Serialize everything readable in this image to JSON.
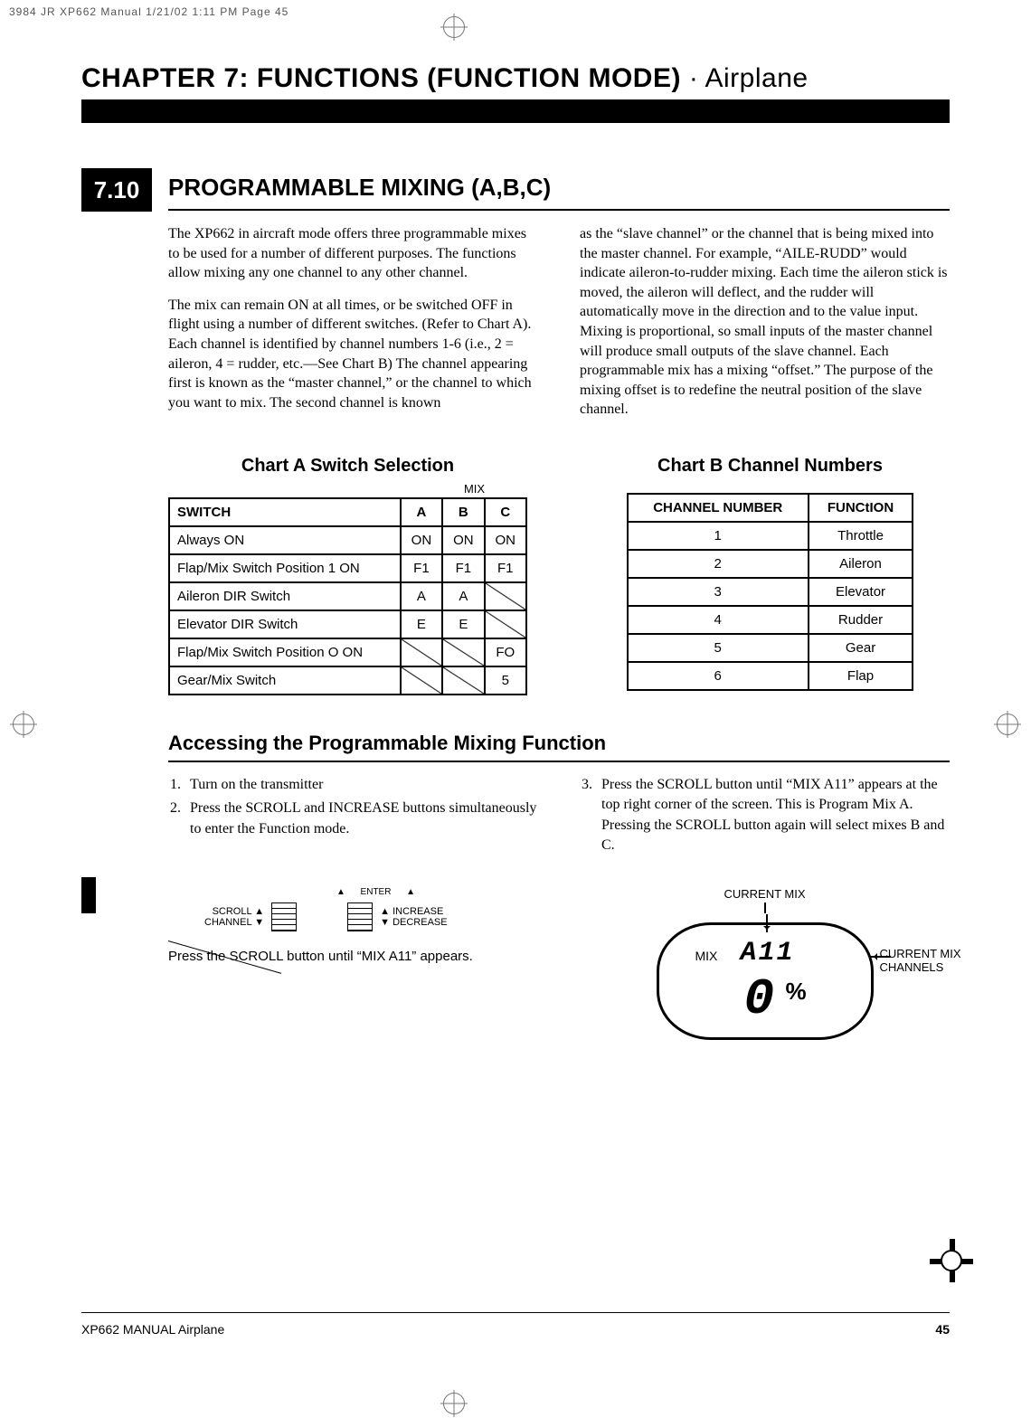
{
  "meta": {
    "print_header": "3984 JR XP662 Manual   1/21/02   1:11 PM   Page 45"
  },
  "chapter": {
    "prefix": "CHAPTER 7: FUNCTIONS (FUNCTION MODE)",
    "suffix_sep": " · ",
    "suffix": "Airplane"
  },
  "section": {
    "number": "7.10",
    "title": "PROGRAMMABLE MIXING (A,B,C)"
  },
  "body": {
    "left_p1": "The XP662 in aircraft mode offers three programmable mixes to be used for a number of different purposes. The functions allow mixing any one channel to any other channel.",
    "left_p2": "The mix can remain ON at all times, or be switched OFF in flight using a number of different switches. (Refer to Chart A). Each channel is identified by channel numbers 1-6 (i.e., 2 = aileron, 4 = rudder, etc.—See Chart B) The channel appearing first is known as the “master channel,” or the channel to which you want to mix. The second channel is known",
    "right_p1": "as the “slave channel” or the channel that is being mixed into the master channel. For example, “AILE-RUDD” would indicate aileron-to-rudder mixing. Each time the aileron stick is moved, the aileron will deflect, and the rudder will automatically move in the direction and to the value input. Mixing is proportional, so small inputs of the master channel will produce small outputs of the slave channel. Each programmable mix has a mixing “offset.” The purpose of the mixing offset is to redefine the neutral position of the slave channel."
  },
  "chartA": {
    "title": "Chart A   Switch Selection",
    "mix_label": "MIX",
    "headers": [
      "SWITCH",
      "A",
      "B",
      "C"
    ]
  },
  "chartB": {
    "title": "Chart B   Channel Numbers",
    "headers": [
      "CHANNEL NUMBER",
      "FUNCtION"
    ]
  },
  "chart_data": [
    {
      "type": "table",
      "title": "Chart A   Switch Selection",
      "columns": [
        "SWITCH",
        "A",
        "B",
        "C"
      ],
      "rows": [
        [
          "Always ON",
          "ON",
          "ON",
          "ON"
        ],
        [
          "Flap/Mix Switch Position 1 ON",
          "F1",
          "F1",
          "F1"
        ],
        [
          "Aileron DIR Switch",
          "A",
          "A",
          null
        ],
        [
          "Elevator DIR Switch",
          "E",
          "E",
          null
        ],
        [
          "Flap/Mix Switch Position O ON",
          null,
          null,
          "FO"
        ],
        [
          "Gear/Mix Switch",
          null,
          null,
          "5"
        ]
      ]
    },
    {
      "type": "table",
      "title": "Chart B   Channel Numbers",
      "columns": [
        "CHANNEL NUMBER",
        "FUNCtION"
      ],
      "rows": [
        [
          "1",
          "Throttle"
        ],
        [
          "2",
          "Aileron"
        ],
        [
          "3",
          "Elevator"
        ],
        [
          "4",
          "Rudder"
        ],
        [
          "5",
          "Gear"
        ],
        [
          "6",
          "Flap"
        ]
      ]
    }
  ],
  "sub": {
    "title": "Accessing the Programmable Mixing Function",
    "step1": "Turn on the transmitter",
    "step2": "Press the SCROLL and INCREASE buttons simultaneously to enter the Function mode.",
    "step3": "Press the SCROLL button until “MIX A11” appears at the top right corner of the screen. This is Program Mix A. Pressing the SCROLL button again will select mixes B and C."
  },
  "tx": {
    "enter": "ENTER",
    "scroll": "SCROLL",
    "channel": "CHANNEL",
    "increase": "INCREASE",
    "decrease": "DECREASE",
    "caption": "Press the SCROLL button until “MIX A11” appears."
  },
  "lcd": {
    "top_label": "CURRENT MIX",
    "mix": "MIX",
    "code": "A11",
    "zero": "0",
    "pct": "%",
    "right_note": "CURRENT MIX CHANNELS"
  },
  "footer": {
    "left": "XP662 MANUAL  Airplane",
    "page": "45"
  }
}
